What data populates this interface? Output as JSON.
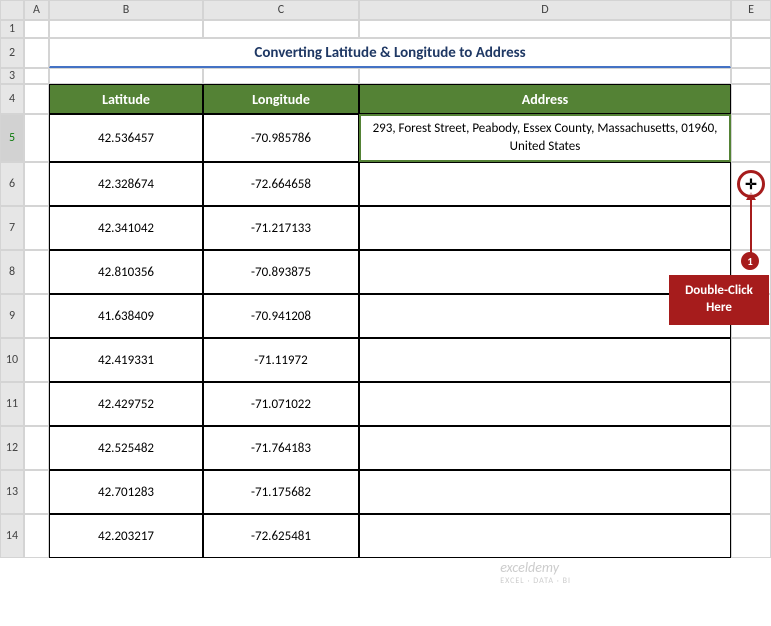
{
  "columns": [
    "A",
    "B",
    "C",
    "D",
    "E"
  ],
  "rows": [
    "1",
    "2",
    "3",
    "4",
    "5",
    "6",
    "7",
    "8",
    "9",
    "10",
    "11",
    "12",
    "13",
    "14"
  ],
  "title": "Converting Latitude & Longitude to Address",
  "headers": {
    "lat": "Latitude",
    "lon": "Longitude",
    "addr": "Address"
  },
  "data_rows": [
    {
      "lat": "42.536457",
      "lon": "-70.985786",
      "addr": "293, Forest Street, Peabody, Essex County, Massachusetts, 01960, United States"
    },
    {
      "lat": "42.328674",
      "lon": "-72.664658",
      "addr": ""
    },
    {
      "lat": "42.341042",
      "lon": "-71.217133",
      "addr": ""
    },
    {
      "lat": "42.810356",
      "lon": "-70.893875",
      "addr": ""
    },
    {
      "lat": "41.638409",
      "lon": "-70.941208",
      "addr": ""
    },
    {
      "lat": "42.419331",
      "lon": "-71.11972",
      "addr": ""
    },
    {
      "lat": "42.429752",
      "lon": "-71.071022",
      "addr": ""
    },
    {
      "lat": "42.525482",
      "lon": "-71.764183",
      "addr": ""
    },
    {
      "lat": "42.701283",
      "lon": "-71.175682",
      "addr": ""
    },
    {
      "lat": "42.203217",
      "lon": "-72.625481",
      "addr": ""
    }
  ],
  "annotation": {
    "step": "1",
    "text": "Double-Click Here",
    "cursor": "✛"
  },
  "watermark": {
    "main": "exceldemy",
    "sub": "EXCEL · DATA · BI"
  }
}
